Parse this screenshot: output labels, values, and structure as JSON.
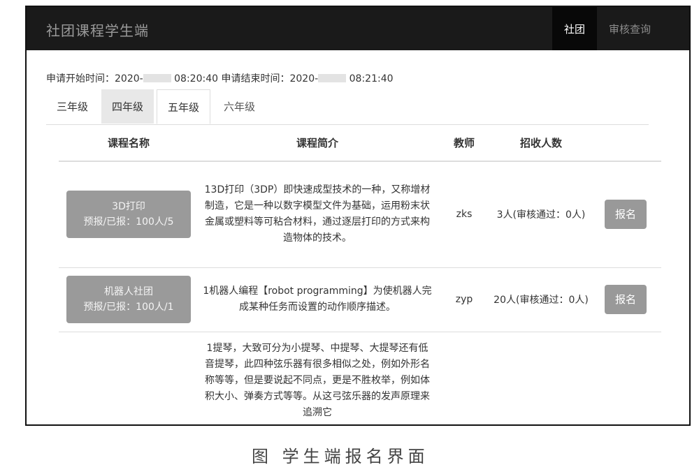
{
  "navbar": {
    "brand": "社团课程学生端",
    "links": [
      {
        "label": "社团",
        "active": true
      },
      {
        "label": "审核查询",
        "active": false
      }
    ]
  },
  "time_info": {
    "start_label": "申请开始时间：",
    "start_date_prefix": "2020-",
    "start_time": "08:20:40",
    "end_label": "申请结束时间：",
    "end_date_prefix": "2020-",
    "end_time": "08:21:40"
  },
  "tabs": [
    {
      "label": "三年级"
    },
    {
      "label": "四年级"
    },
    {
      "label": "五年级",
      "active": true
    },
    {
      "label": "六年级"
    }
  ],
  "table": {
    "headers": [
      "课程名称",
      "课程简介",
      "教师",
      "招收人数",
      ""
    ],
    "rows": [
      {
        "course_name": "3D打印",
        "course_stat": "预报/已报：100人/5",
        "intro": "13D打印（3DP）即快速成型技术的一种，又称增材制造，它是一种以数字模型文件为基础，运用粉末状金属或塑料等可粘合材料，通过逐层打印的方式来构造物体的技术。",
        "teacher": "zks",
        "enroll": "3人(审核通过：0人)",
        "action": "报名"
      },
      {
        "course_name": "机器人社团",
        "course_stat": "预报/已报：100人/1",
        "intro": "1机器人编程【robot programming】为使机器人完成某种任务而设置的动作顺序描述。",
        "teacher": "zyp",
        "enroll": "20人(审核通过：0人)",
        "action": "报名"
      },
      {
        "course_name": "",
        "course_stat": "",
        "intro": "1提琴，大致可分为小提琴、中提琴、大提琴还有低音提琴，此四种弦乐器有很多相似之处，例如外形名称等等，但是要说起不同点，更是不胜枚举，例如体积大小、弹奏方式等等。从这弓弦乐器的发声原理来追溯它",
        "teacher": "",
        "enroll": "",
        "action": ""
      }
    ]
  },
  "caption": "图 学生端报名界面",
  "colors": {
    "navbar_bg": "#1a1a1a",
    "button_gray": "#9a9a9a"
  }
}
